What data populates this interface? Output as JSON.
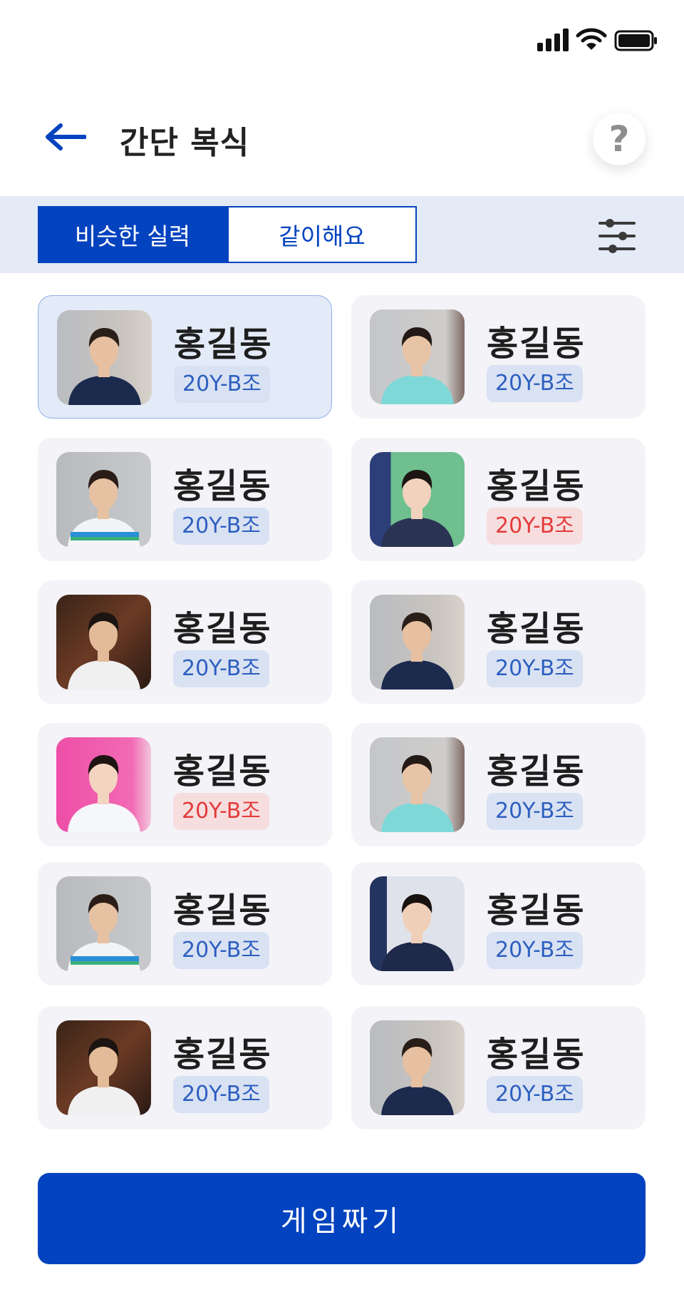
{
  "header": {
    "title": "간단 복식"
  },
  "tabs": [
    {
      "label": "비슷한 실력",
      "active": true
    },
    {
      "label": "같이해요",
      "active": false
    }
  ],
  "colors": {
    "primary": "#0343bf",
    "badge_blue_bg": "#d9e2f3",
    "badge_blue_text": "#2d5fbf",
    "badge_red_bg": "#f7dede",
    "badge_red_text": "#e23b3b",
    "card_bg": "#f3f3f8",
    "selected_card_bg": "#e3eaf8"
  },
  "players": [
    {
      "name": "홍길동",
      "group": "20Y-B조",
      "badge_color": "blue",
      "selected": true,
      "photo": "man-navy-shirt"
    },
    {
      "name": "홍길동",
      "group": "20Y-B조",
      "badge_color": "blue",
      "selected": false,
      "photo": "man-mint-shirt"
    },
    {
      "name": "홍길동",
      "group": "20Y-B조",
      "badge_color": "blue",
      "selected": false,
      "photo": "man-white-striped-shirt"
    },
    {
      "name": "홍길동",
      "group": "20Y-B조",
      "badge_color": "red",
      "selected": false,
      "photo": "woman-navy-shirt"
    },
    {
      "name": "홍길동",
      "group": "20Y-B조",
      "badge_color": "blue",
      "selected": false,
      "photo": "man-white-racket"
    },
    {
      "name": "홍길동",
      "group": "20Y-B조",
      "badge_color": "blue",
      "selected": false,
      "photo": "man-navy-shirt"
    },
    {
      "name": "홍길동",
      "group": "20Y-B조",
      "badge_color": "red",
      "selected": false,
      "photo": "woman-pink-bg"
    },
    {
      "name": "홍길동",
      "group": "20Y-B조",
      "badge_color": "blue",
      "selected": false,
      "photo": "man-mint-shirt"
    },
    {
      "name": "홍길동",
      "group": "20Y-B조",
      "badge_color": "blue",
      "selected": false,
      "photo": "man-white-striped-shirt"
    },
    {
      "name": "홍길동",
      "group": "20Y-B조",
      "badge_color": "blue",
      "selected": false,
      "photo": "woman-racket-navy"
    },
    {
      "name": "홍길동",
      "group": "20Y-B조",
      "badge_color": "blue",
      "selected": false,
      "photo": "man-white-racket"
    },
    {
      "name": "홍길동",
      "group": "20Y-B조",
      "badge_color": "blue",
      "selected": false,
      "photo": "man-navy-shirt"
    }
  ],
  "cta": {
    "label": "게임짜기"
  },
  "icons": {
    "back": "arrow-left-icon",
    "help": "question-mark-icon",
    "filter": "sliders-icon",
    "signal": "cellular-signal-icon",
    "wifi": "wifi-icon",
    "battery": "battery-icon"
  },
  "help_glyph": "?"
}
